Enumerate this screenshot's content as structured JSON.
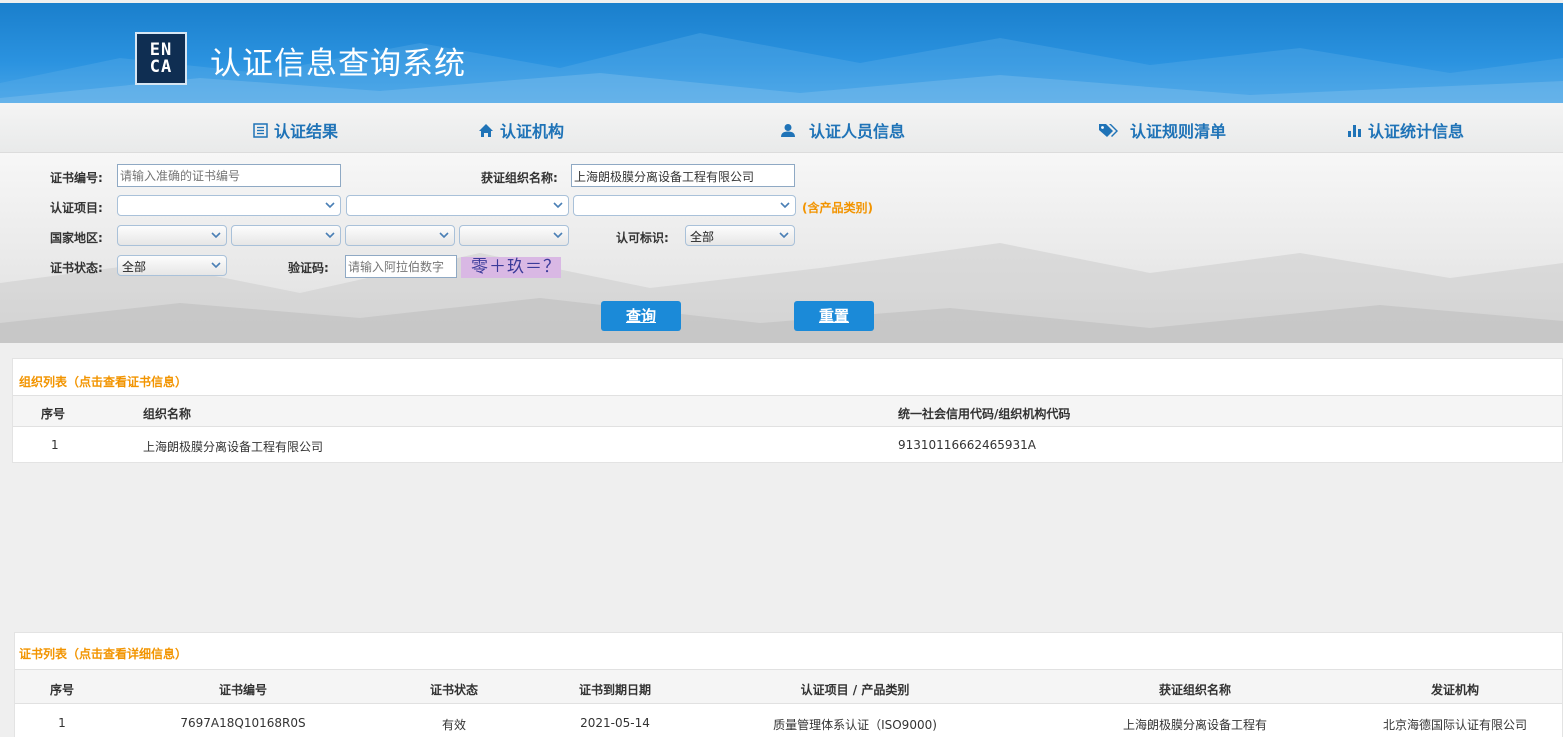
{
  "header": {
    "logo_top": "EN",
    "logo_bottom": "CA",
    "title": "认证信息查询系统"
  },
  "nav": [
    {
      "label": "认证结果",
      "icon": "list-icon"
    },
    {
      "label": "认证机构",
      "icon": "home-icon"
    },
    {
      "label": "认证人员信息",
      "icon": "user-icon"
    },
    {
      "label": "认证规则清单",
      "icon": "tags-icon"
    },
    {
      "label": "认证统计信息",
      "icon": "bar-chart-icon"
    }
  ],
  "form": {
    "cert_no_label": "证书编号:",
    "cert_no_placeholder": "请输入准确的证书编号",
    "org_name_label": "获证组织名称:",
    "org_name_value": "上海朗极膜分离设备工程有限公司",
    "project_label": "认证项目:",
    "product_hint": "(含产品类别)",
    "region_label": "国家地区:",
    "mark_label": "认可标识:",
    "mark_value": "全部",
    "status_label": "证书状态:",
    "status_value": "全部",
    "captcha_label": "验证码:",
    "captcha_placeholder": "请输入阿拉伯数字",
    "captcha_text": "零＋玖＝？",
    "query_button": "查询",
    "reset_button": "重置"
  },
  "org_list": {
    "title": "组织列表（点击查看证书信息）",
    "columns": [
      "序号",
      "组织名称",
      "统一社会信用代码/组织机构代码"
    ],
    "rows": [
      [
        "1",
        "上海朗极膜分离设备工程有限公司",
        "91310116662465931A"
      ]
    ]
  },
  "cert_list": {
    "title": "证书列表（点击查看详细信息）",
    "columns": [
      "序号",
      "证书编号",
      "证书状态",
      "证书到期日期",
      "认证项目 / 产品类别",
      "获证组织名称",
      "发证机构"
    ],
    "rows": [
      [
        "1",
        "7697A18Q10168R0S",
        "有效",
        "2021-05-14",
        "质量管理体系认证（ISO9000)",
        "上海朗极膜分离设备工程有",
        "北京海德国际认证有限公司"
      ]
    ]
  },
  "colors": {
    "header_blue": "#2b93e0",
    "nav_text": "#1f73b7",
    "button_blue": "#1b8ad8",
    "accent_orange": "#f29400"
  }
}
